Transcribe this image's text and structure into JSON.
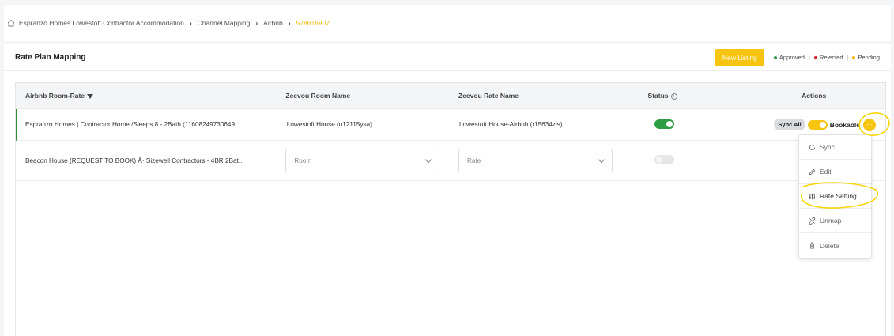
{
  "breadcrumb": {
    "items": [
      "Espranzo Homes Lowestoft Contractor Accommodation",
      "Channel Mapping",
      "Airbnb"
    ],
    "current": "578616907"
  },
  "header": {
    "title": "Rate Plan Mapping",
    "new_listing_label": "New Listing",
    "legend": {
      "approved": "Approved",
      "rejected": "Rejected",
      "pending": "Pending"
    }
  },
  "table": {
    "columns": {
      "room_rate": "Airbnb Room-Rate",
      "room_name": "Zeevou Room Name",
      "rate_name": "Zeevou Rate Name",
      "status": "Status",
      "actions": "Actions"
    },
    "rows": [
      {
        "room_rate": "Espranzo Homes | Contractor Home /Sleeps 8 - 2Bath (11608249730649...",
        "room_name": "Lowestoft House (u12115ysa)",
        "rate_name": "Lowestoft House-Airbnb (r15634zis)",
        "status_on": true
      },
      {
        "room_rate": "Beacon House (REQUEST TO BOOK) Â· Sizewell Contractors - 4BR 2Bat...",
        "room_placeholder": "Room",
        "rate_placeholder": "Rate",
        "status_on": false
      }
    ],
    "actions": {
      "sync_all_label": "Sync All",
      "bookable_label": "Bookable",
      "more_glyph": "···"
    }
  },
  "menu": {
    "items": [
      {
        "label": "Sync",
        "icon": "sync-icon"
      },
      {
        "label": "Edit",
        "icon": "edit-icon"
      },
      {
        "label": "Rate Setting",
        "icon": "sliders-icon"
      },
      {
        "label": "Unmap",
        "icon": "unlink-icon"
      },
      {
        "label": "Delete",
        "icon": "trash-icon"
      }
    ]
  },
  "colors": {
    "accent": "#f7c40f",
    "approved": "#2e9e45",
    "rejected": "#d9232e",
    "pending": "#f2b705"
  }
}
